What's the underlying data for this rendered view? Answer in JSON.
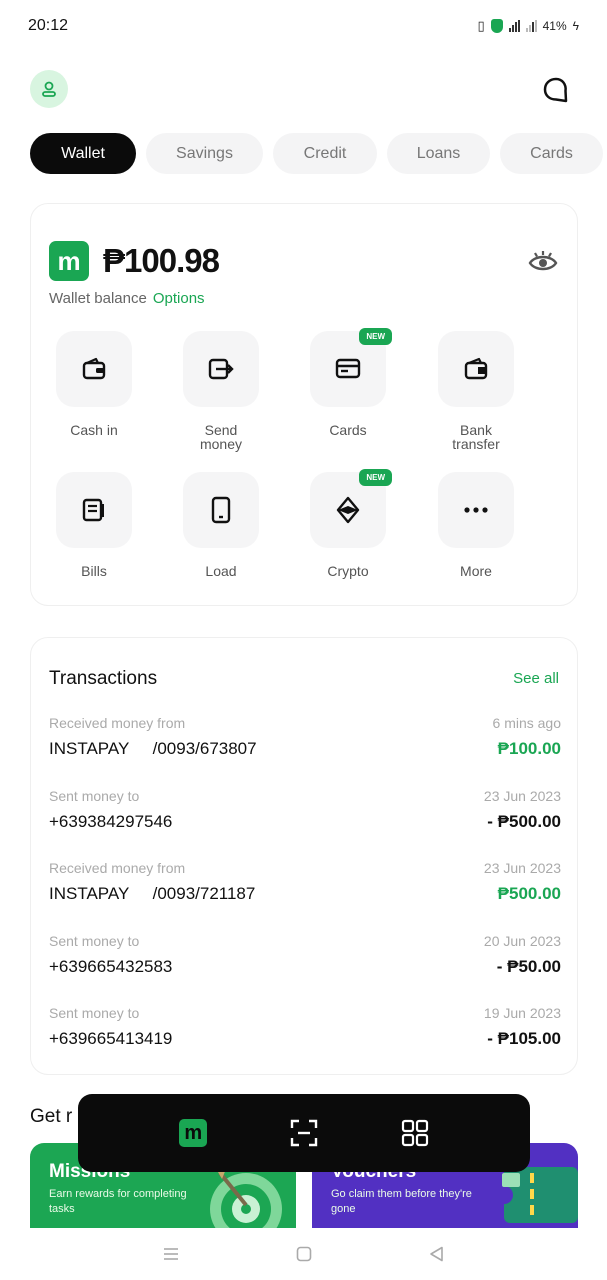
{
  "status": {
    "time": "20:12",
    "battery": "41%"
  },
  "topbar": {
    "profile_icon": "user-icon",
    "chat_icon": "chat-bubble-icon"
  },
  "tabs": [
    {
      "label": "Wallet",
      "active": true
    },
    {
      "label": "Savings",
      "active": false
    },
    {
      "label": "Credit",
      "active": false
    },
    {
      "label": "Loans",
      "active": false
    },
    {
      "label": "Cards",
      "active": false
    }
  ],
  "wallet": {
    "logo_letter": "m",
    "balance": "₱100.98",
    "balance_label": "Wallet balance",
    "options_label": "Options",
    "accent": "#1aa653"
  },
  "actions": [
    {
      "label": "Cash in",
      "icon": "wallet-icon",
      "badge": ""
    },
    {
      "label": "Send\nmoney",
      "icon": "send-money-icon",
      "badge": ""
    },
    {
      "label": "Cards",
      "icon": "card-icon",
      "badge": "NEW"
    },
    {
      "label": "Bank\ntransfer",
      "icon": "bank-transfer-icon",
      "badge": ""
    },
    {
      "label": "Bills",
      "icon": "bills-icon",
      "badge": ""
    },
    {
      "label": "Load",
      "icon": "phone-icon",
      "badge": ""
    },
    {
      "label": "Crypto",
      "icon": "crypto-icon",
      "badge": "NEW"
    },
    {
      "label": "More",
      "icon": "more-icon",
      "badge": ""
    }
  ],
  "transactions": {
    "title": "Transactions",
    "see_all": "See all",
    "items": [
      {
        "desc": "Received money from",
        "party": "INSTAPAY     /0093/673807",
        "time": "6 mins ago",
        "amount": "₱100.00",
        "incoming": true
      },
      {
        "desc": "Sent money to",
        "party": "+639384297546",
        "time": "23 Jun 2023",
        "amount": "- ₱500.00",
        "incoming": false
      },
      {
        "desc": "Received money from",
        "party": "INSTAPAY     /0093/721187",
        "time": "23 Jun 2023",
        "amount": "₱500.00",
        "incoming": true
      },
      {
        "desc": "Sent money to",
        "party": "+639665432583",
        "time": "20 Jun 2023",
        "amount": "- ₱50.00",
        "incoming": false
      },
      {
        "desc": "Sent money to",
        "party": "+639665413419",
        "time": "19 Jun 2023",
        "amount": "- ₱105.00",
        "incoming": false
      }
    ]
  },
  "get_section": {
    "label": "Get r"
  },
  "promos": {
    "missions": {
      "title": "Missions",
      "desc": "Earn rewards for completing tasks",
      "color": "#1ca653"
    },
    "vouchers": {
      "title": "Vouchers",
      "desc": "Go claim them before they're gone",
      "color": "#5230c2"
    }
  },
  "floatbar": {
    "home_letter": "m",
    "scan_icon": "scan-icon",
    "apps_icon": "grid-icon"
  }
}
